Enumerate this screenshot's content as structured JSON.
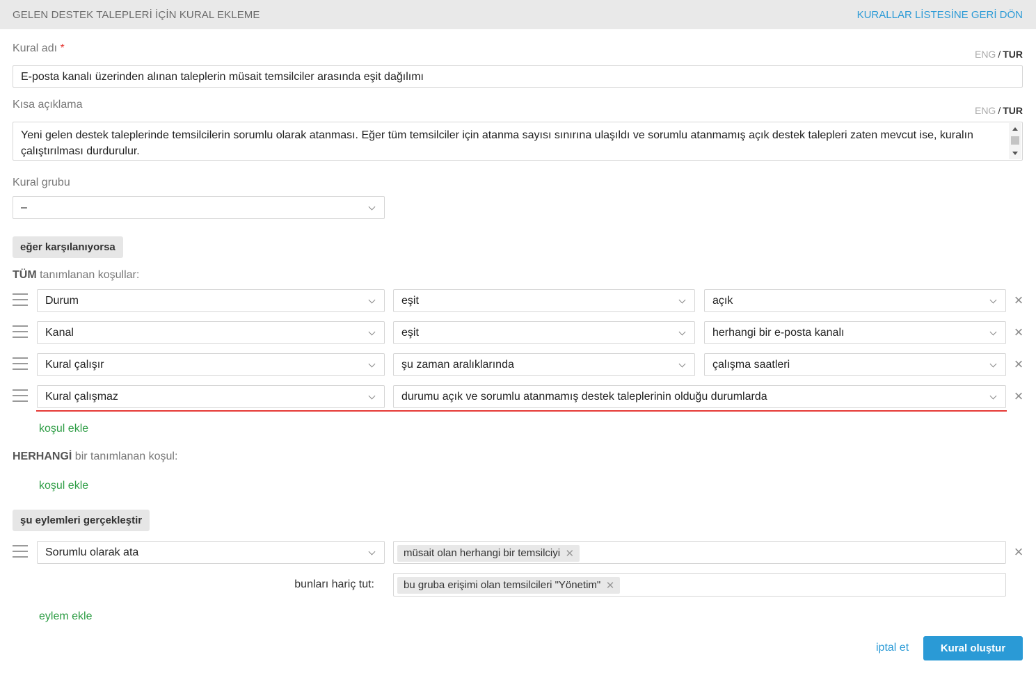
{
  "header": {
    "title": "GELEN DESTEK TALEPLERİ İÇİN KURAL EKLEME",
    "back_link": "KURALLAR LİSTESİNE GERİ DÖN"
  },
  "name_field": {
    "label": "Kural adı",
    "required_mark": "*",
    "value": "E-posta kanalı üzerinden alınan taleplerin müsait temsilciler arasında eşit dağılımı"
  },
  "description_field": {
    "label": "Kısa açıklama",
    "value": "Yeni gelen destek taleplerinde temsilcilerin sorumlu olarak atanması. Eğer tüm temsilciler için atanma sayısı sınırına ulaşıldı ve sorumlu atanmamış açık destek talepleri zaten mevcut ise, kuralın çalıştırılması durdurulur."
  },
  "lang_switch": {
    "eng": "ENG",
    "sep": "/",
    "tur": "TUR",
    "active": "TUR"
  },
  "group_field": {
    "label": "Kural grubu",
    "value": "–"
  },
  "conditions": {
    "section_label": "eğer karşılanıyorsa",
    "all_prefix": "TÜM",
    "all_suffix": "tanımlanan koşullar:",
    "rows": [
      {
        "field": "Durum",
        "operator": "eşit",
        "value": "açık"
      },
      {
        "field": "Kanal",
        "operator": "eşit",
        "value": "herhangi bir e-posta kanalı"
      },
      {
        "field": "Kural çalışır",
        "operator": "şu zaman aralıklarında",
        "value": "çalışma saatleri"
      },
      {
        "field": "Kural çalışmaz",
        "operator": "durumu açık ve sorumlu atanmamış destek taleplerinin olduğu durumlarda"
      }
    ],
    "add_condition": "koşul ekle",
    "any_prefix": "HERHANGİ",
    "any_suffix": "bir tanımlanan koşul:",
    "add_condition_any": "koşul ekle"
  },
  "actions": {
    "section_label": "şu eylemleri gerçekleştir",
    "rows": [
      {
        "action": "Sorumlu olarak ata",
        "tags": [
          "müsait olan herhangi bir temsilciyi"
        ],
        "exclude_label": "bunları hariç tut:",
        "exclude_tags": [
          "bu gruba erişimi olan temsilcileri \"Yönetim\""
        ]
      }
    ],
    "add_action": "eylem ekle"
  },
  "footer": {
    "cancel": "iptal et",
    "submit": "Kural oluştur"
  },
  "colors": {
    "accent_blue": "#2a9ad6",
    "link_green": "#2e9d45",
    "error_red": "#e53935"
  },
  "icons": {
    "drag": "drag-handle-icon",
    "remove": "close-icon",
    "dropdown": "chevron-down-icon"
  }
}
